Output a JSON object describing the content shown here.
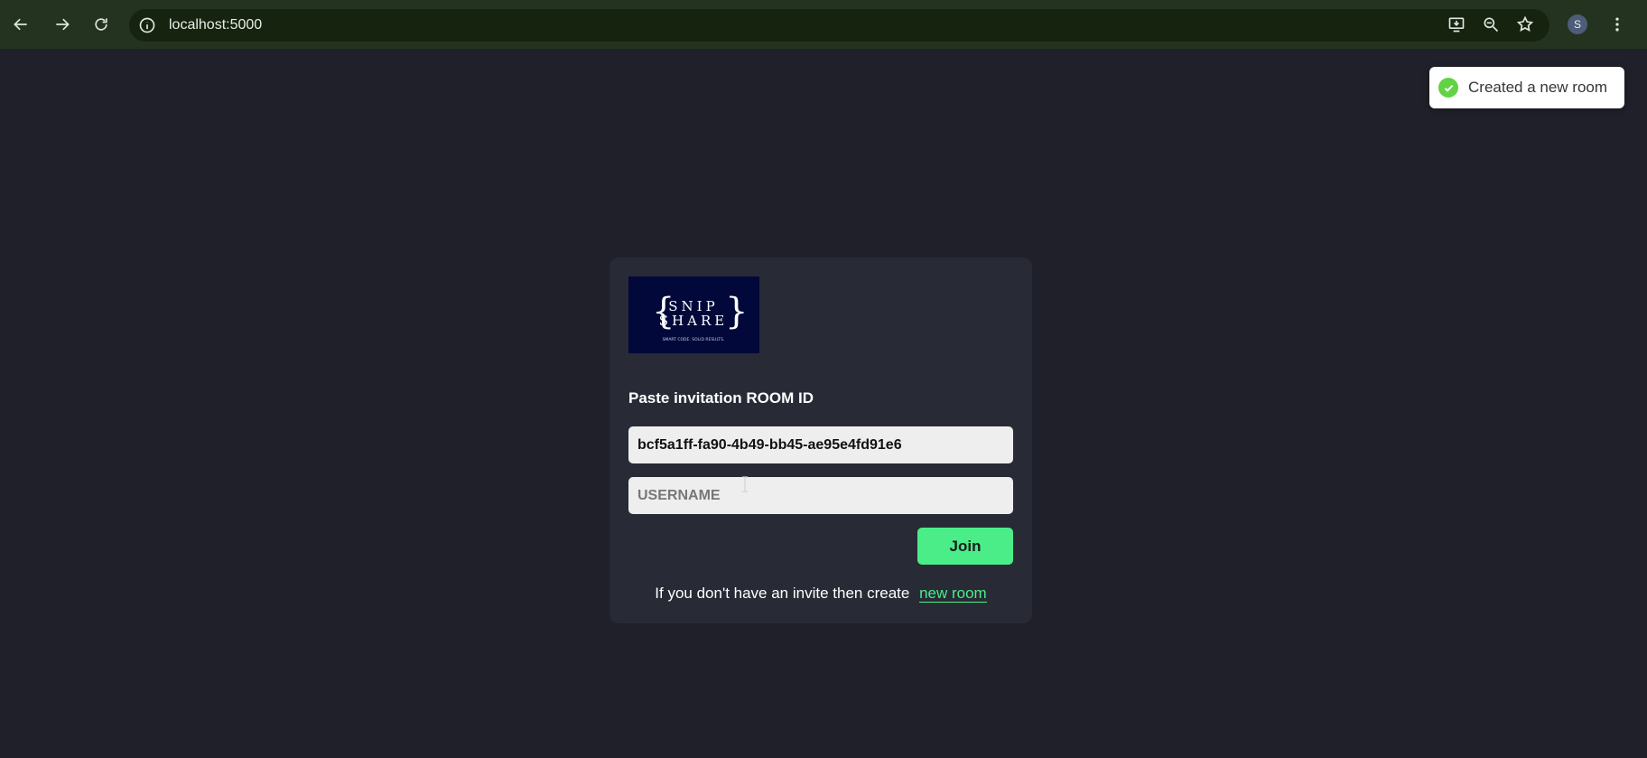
{
  "browser": {
    "url": "localhost:5000",
    "profile_initial": "S",
    "icons": [
      "back-icon",
      "forward-icon",
      "reload-icon",
      "site-info-icon",
      "install-app-icon",
      "zoom-icon",
      "bookmark-star-icon",
      "menu-icon"
    ]
  },
  "toast": {
    "message": "Created a new room",
    "status_color": "#61d345"
  },
  "join_form": {
    "logo_text_line1": "SNIP",
    "logo_text_line2": "SHARE",
    "logo_tagline": "SMART CODE. SOLID RESULTS.",
    "title": "Paste invitation ROOM ID",
    "room_id_value": "bcf5a1ff-fa90-4b49-bb45-ae95e4fd91e6",
    "username_placeholder": "USERNAME",
    "username_value": "",
    "join_label": "Join",
    "create_info_text": "If you don't have an invite then create",
    "new_room_link": "new room"
  },
  "colors": {
    "accent": "#4aed88",
    "background": "#1f2029",
    "card": "#282a36",
    "logo_bg": "#02083a"
  }
}
